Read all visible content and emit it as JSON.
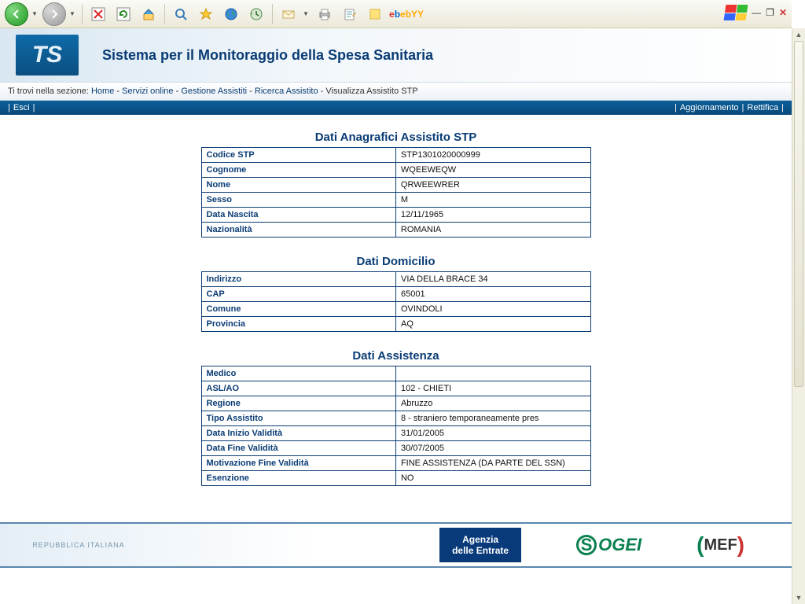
{
  "header": {
    "title": "Sistema per il Monitoraggio della Spesa Sanitaria",
    "logo_text": "TS"
  },
  "breadcrumb": {
    "prefix": "Ti trovi nella sezione:",
    "items": [
      "Home",
      "Servizi online",
      "Gestione Assistiti",
      "Ricerca Assistito",
      "Visualizza Assistito STP"
    ]
  },
  "actionbar": {
    "left": [
      "Esci"
    ],
    "right": [
      "Aggiornamento",
      "Rettifica"
    ]
  },
  "sections": [
    {
      "title": "Dati Anagrafici Assistito STP",
      "rows": [
        {
          "label": "Codice STP",
          "value": "STP1301020000999"
        },
        {
          "label": "Cognome",
          "value": "WQEEWEQW"
        },
        {
          "label": "Nome",
          "value": "QRWEEWRER"
        },
        {
          "label": "Sesso",
          "value": "M"
        },
        {
          "label": "Data Nascita",
          "value": "12/11/1965"
        },
        {
          "label": "Nazionalità",
          "value": "ROMANIA"
        }
      ]
    },
    {
      "title": "Dati Domicilio",
      "rows": [
        {
          "label": "Indirizzo",
          "value": "VIA DELLA BRACE 34"
        },
        {
          "label": "CAP",
          "value": "65001"
        },
        {
          "label": "Comune",
          "value": "OVINDOLI"
        },
        {
          "label": "Provincia",
          "value": "AQ"
        }
      ]
    },
    {
      "title": "Dati Assistenza",
      "rows": [
        {
          "label": "Medico",
          "value": ""
        },
        {
          "label": "ASL/AO",
          "value": "102 - CHIETI"
        },
        {
          "label": "Regione",
          "value": "Abruzzo"
        },
        {
          "label": "Tipo Assistito",
          "value": "8 - straniero temporaneamente pres"
        },
        {
          "label": "Data Inizio Validità",
          "value": "31/01/2005"
        },
        {
          "label": "Data Fine Validità",
          "value": "30/07/2005"
        },
        {
          "label": "Motivazione Fine Validità",
          "value": "FINE ASSISTENZA (DA PARTE DEL SSN)"
        },
        {
          "label": "Esenzione",
          "value": "NO"
        }
      ]
    }
  ],
  "footer": {
    "seal": "REPUBBLICA ITALIANA",
    "agenzia_line1": "Agenzia",
    "agenzia_line2": "delle Entrate",
    "sogei": "OGEI",
    "mef": "MEF"
  },
  "toolbar": {
    "ebay": "ebY"
  }
}
